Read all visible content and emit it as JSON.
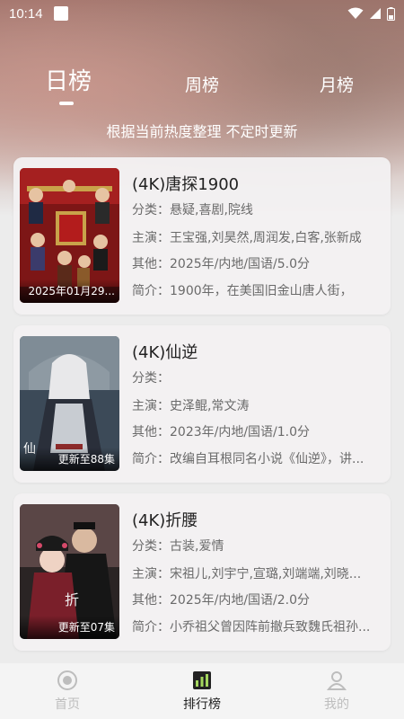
{
  "status_bar": {
    "time": "10:14",
    "icons": [
      "app-square-icon",
      "wifi-icon",
      "signal-icon",
      "battery-icon"
    ]
  },
  "tabs": [
    {
      "label": "日榜",
      "active": true
    },
    {
      "label": "周榜",
      "active": false
    },
    {
      "label": "月榜",
      "active": false
    }
  ],
  "subtitle": "根据当前热度整理 不定时更新",
  "items": [
    {
      "title": "(4K)唐探1900",
      "category": "分类：悬疑,喜剧,院线",
      "cast": "主演：王宝强,刘昊然,周润发,白客,张新成",
      "other": "其他：2025年/内地/国语/5.0分",
      "intro": "简介：1900年，在美国旧金山唐人街，",
      "poster_tag": "2025年01月29..."
    },
    {
      "title": "(4K)仙逆",
      "category": "分类：",
      "cast": "主演：史泽鲲,常文涛",
      "other": "其他：2023年/内地/国语/1.0分",
      "intro": "简介：改编自耳根同名小说《仙逆》，讲...",
      "poster_tag": "更新至88集"
    },
    {
      "title": "(4K)折腰",
      "category": "分类：古装,爱情",
      "cast": "主演：宋祖儿,刘宇宁,宣璐,刘端端,刘晓...",
      "other": "其他：2025年/内地/国语/2.0分",
      "intro": "简介：小乔祖父曾因阵前撤兵致魏氏祖孙...",
      "poster_tag": "更新至07集"
    }
  ],
  "nav": [
    {
      "label": "首页",
      "icon": "home-icon",
      "active": false
    },
    {
      "label": "排行榜",
      "icon": "ranking-icon",
      "active": true
    },
    {
      "label": "我的",
      "icon": "profile-icon",
      "active": false
    }
  ],
  "colors": {
    "active_text": "#222222",
    "inactive_nav": "#bdbdbd",
    "card_bg": "#f3f0f1",
    "secondary_text": "#6a6a6a"
  }
}
